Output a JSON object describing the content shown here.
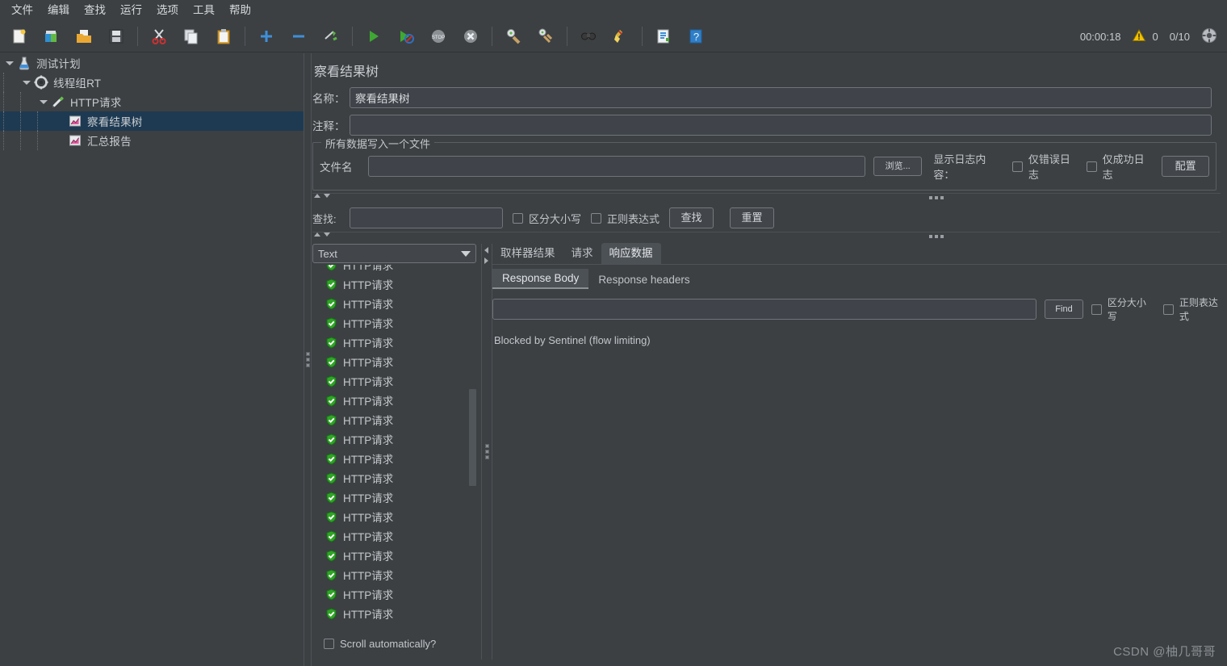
{
  "menubar": {
    "items": [
      {
        "label": "文件",
        "name": "menu-file"
      },
      {
        "label": "编辑",
        "name": "menu-edit"
      },
      {
        "label": "查找",
        "name": "menu-search"
      },
      {
        "label": "运行",
        "name": "menu-run"
      },
      {
        "label": "选项",
        "name": "menu-options"
      },
      {
        "label": "工具",
        "name": "menu-tools"
      },
      {
        "label": "帮助",
        "name": "menu-help"
      }
    ]
  },
  "toolbar": {
    "status": {
      "elapsed": "00:00:18",
      "warning_count": "0",
      "threads_ratio": "0/10"
    },
    "icons": [
      "new-icon",
      "templates-icon",
      "open-icon",
      "save-icon",
      "cut-icon",
      "copy-icon",
      "paste-icon",
      "expand-icon",
      "collapse-icon",
      "toggle-icon",
      "start-icon",
      "start-no-pauses-icon",
      "stop-icon",
      "shutdown-icon",
      "clear-icon",
      "clear-all-icon",
      "search-icon",
      "search-reset-icon",
      "function-helper-icon",
      "help-icon"
    ]
  },
  "tree": {
    "nodes": [
      {
        "label": "测试计划",
        "icon": "test-plan-icon",
        "depth": 0,
        "expanded": true,
        "selected": false,
        "name": "tree-node-test-plan"
      },
      {
        "label": "线程组RT",
        "icon": "thread-group-icon",
        "depth": 1,
        "expanded": true,
        "selected": false,
        "name": "tree-node-thread-group"
      },
      {
        "label": "HTTP请求",
        "icon": "http-sampler-icon",
        "depth": 2,
        "expanded": true,
        "selected": false,
        "name": "tree-node-http-request"
      },
      {
        "label": "察看结果树",
        "icon": "view-results-tree-icon",
        "depth": 3,
        "expanded": false,
        "selected": true,
        "name": "tree-node-view-results-tree"
      },
      {
        "label": "汇总报告",
        "icon": "summary-report-icon",
        "depth": 3,
        "expanded": false,
        "selected": false,
        "name": "tree-node-summary-report"
      }
    ]
  },
  "panel": {
    "title": "察看结果树",
    "name_label": "名称：",
    "name_value": "察看结果树",
    "comment_label": "注释：",
    "comment_value": "",
    "file_group": {
      "legend": "所有数据写入一个文件",
      "filename_label": "文件名",
      "filename_value": "",
      "browse_button": "浏览...",
      "log_display_label": "显示日志内容：",
      "errors_only": "仅错误日志",
      "successes_only": "仅成功日志",
      "configure_button": "配置"
    },
    "search_bar": {
      "label": "查找:",
      "value": "",
      "case_sensitive": "区分大小写",
      "regexp": "正则表达式",
      "find_button": "查找",
      "reset_button": "重置"
    },
    "renderer": {
      "selected": "Text"
    },
    "sampler_results": {
      "item_label": "HTTP请求",
      "count": 19,
      "status": "success",
      "scroll_automatically": "Scroll automatically?"
    },
    "tabs": [
      {
        "label": "取样器结果",
        "active": false,
        "name": "tab-sampler-result"
      },
      {
        "label": "请求",
        "active": false,
        "name": "tab-request"
      },
      {
        "label": "响应数据",
        "active": true,
        "name": "tab-response-data"
      }
    ],
    "subtabs": [
      {
        "label": "Response Body",
        "active": true,
        "name": "subtab-response-body"
      },
      {
        "label": "Response headers",
        "active": false,
        "name": "subtab-response-headers"
      }
    ],
    "response_find": {
      "value": "",
      "find_button": "Find",
      "case_sensitive": "区分大小写",
      "regexp": "正则表达式"
    },
    "response_body_text": "Blocked by Sentinel (flow limiting)"
  },
  "watermark": "CSDN @柚几哥哥",
  "colors": {
    "background": "#3c4043",
    "selection": "#1e3a52",
    "text": "#c3c7cb",
    "success_green": "#3fae2a",
    "warning_yellow": "#f2c200"
  }
}
